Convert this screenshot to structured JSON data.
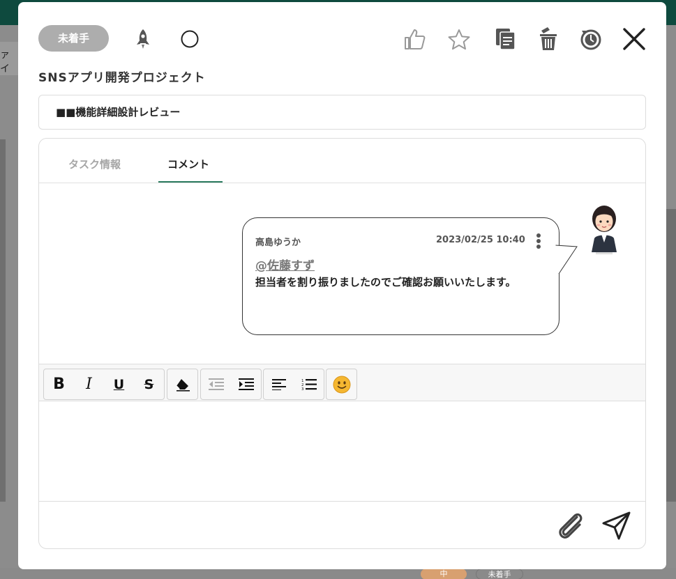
{
  "background": {
    "strip_text": "ァイ",
    "chip_priority": "中",
    "chip_status": "未着手"
  },
  "modal": {
    "status": "未着手",
    "project_title": "SNSアプリ開発プロジェクト",
    "task_title": "■■機能詳細設計レビュー",
    "tabs": [
      {
        "label": "タスク情報",
        "active": false
      },
      {
        "label": "コメント",
        "active": true
      }
    ],
    "comment": {
      "author": "高島ゆうか",
      "timestamp": "2023/02/25 10:40",
      "mention": "@佐藤すず",
      "text": "担当者を割り振りましたのでご確認お願いいたします。"
    },
    "header_icons": [
      "rocket-icon",
      "circle-icon",
      "thumbs-up-icon",
      "star-icon",
      "copy-icon",
      "trash-icon",
      "history-icon",
      "close-icon"
    ],
    "toolbar_icons": [
      "bold-icon",
      "italic-icon",
      "underline-icon",
      "strikethrough-icon",
      "eraser-icon",
      "outdent-icon",
      "indent-icon",
      "align-left-icon",
      "ordered-list-icon",
      "emoji-icon"
    ],
    "footer_icons": [
      "paperclip-icon",
      "send-icon"
    ],
    "colors": {
      "status_pill": "#adadad",
      "tab_underline": "#2a7a5e",
      "topbar": "#0e4a3e"
    }
  }
}
